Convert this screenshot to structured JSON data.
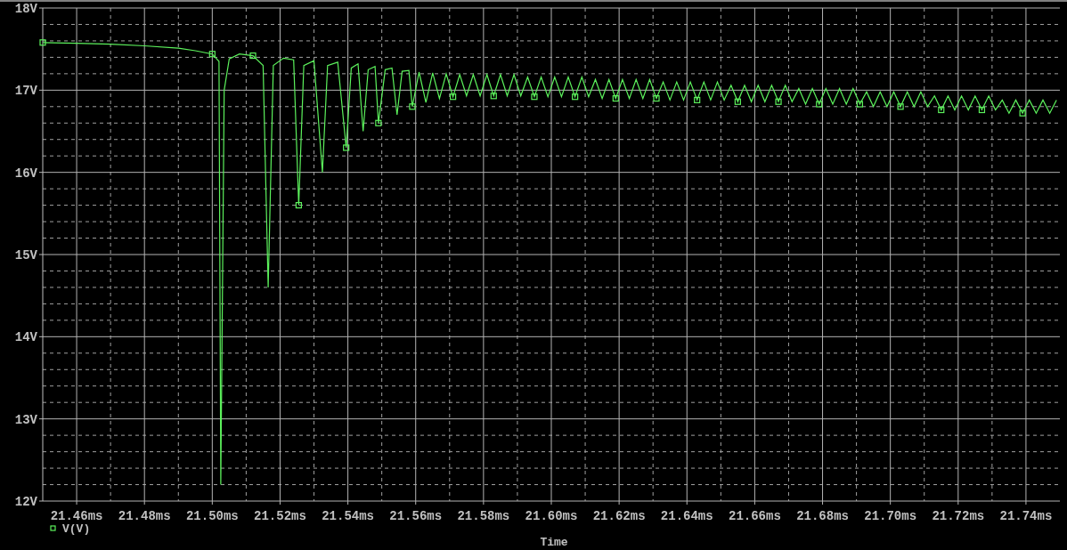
{
  "plot": {
    "chart_data": {
      "type": "line",
      "grid": true,
      "xlabel": "Time",
      "xlim": [
        21.45,
        21.75
      ],
      "ylim": [
        12,
        18
      ],
      "xticks": [
        {
          "value": 21.46,
          "label": "21.46ms"
        },
        {
          "value": 21.48,
          "label": "21.48ms"
        },
        {
          "value": 21.5,
          "label": "21.50ms"
        },
        {
          "value": 21.52,
          "label": "21.52ms"
        },
        {
          "value": 21.54,
          "label": "21.54ms"
        },
        {
          "value": 21.56,
          "label": "21.56ms"
        },
        {
          "value": 21.58,
          "label": "21.58ms"
        },
        {
          "value": 21.6,
          "label": "21.60ms"
        },
        {
          "value": 21.62,
          "label": "21.62ms"
        },
        {
          "value": 21.64,
          "label": "21.64ms"
        },
        {
          "value": 21.66,
          "label": "21.66ms"
        },
        {
          "value": 21.68,
          "label": "21.68ms"
        },
        {
          "value": 21.7,
          "label": "21.70ms"
        },
        {
          "value": 21.72,
          "label": "21.72ms"
        },
        {
          "value": 21.74,
          "label": "21.74ms"
        }
      ],
      "yticks": [
        {
          "value": 12,
          "label": "12V"
        },
        {
          "value": 13,
          "label": "13V"
        },
        {
          "value": 14,
          "label": "14V"
        },
        {
          "value": 15,
          "label": "15V"
        },
        {
          "value": 16,
          "label": "16V"
        },
        {
          "value": 17,
          "label": "17V"
        },
        {
          "value": 18,
          "label": "18V"
        }
      ],
      "x": [
        21.45,
        21.46,
        21.47,
        21.48,
        21.49,
        21.495,
        21.5,
        21.502,
        21.5025,
        21.5035,
        21.505,
        21.508,
        21.512,
        21.515,
        21.5165,
        21.518,
        21.521,
        21.524,
        21.5255,
        21.527,
        21.53,
        21.5325,
        21.534,
        21.537,
        21.5395,
        21.541,
        21.543,
        21.5445,
        21.546,
        21.548,
        21.549,
        21.551,
        21.553,
        21.5545,
        21.556,
        21.558,
        21.559,
        21.561,
        21.563,
        21.565,
        21.567,
        21.569,
        21.571,
        21.573,
        21.575,
        21.577,
        21.579,
        21.581,
        21.583,
        21.585,
        21.587,
        21.589,
        21.591,
        21.593,
        21.595,
        21.597,
        21.599,
        21.601,
        21.603,
        21.605,
        21.607,
        21.609,
        21.611,
        21.613,
        21.615,
        21.617,
        21.619,
        21.621,
        21.623,
        21.625,
        21.627,
        21.629,
        21.631,
        21.633,
        21.635,
        21.637,
        21.639,
        21.641,
        21.643,
        21.645,
        21.647,
        21.649,
        21.651,
        21.653,
        21.655,
        21.657,
        21.659,
        21.661,
        21.663,
        21.665,
        21.667,
        21.669,
        21.671,
        21.673,
        21.675,
        21.677,
        21.679,
        21.681,
        21.683,
        21.685,
        21.687,
        21.689,
        21.691,
        21.693,
        21.695,
        21.697,
        21.699,
        21.701,
        21.703,
        21.705,
        21.707,
        21.709,
        21.711,
        21.713,
        21.715,
        21.717,
        21.719,
        21.721,
        21.723,
        21.725,
        21.727,
        21.729,
        21.731,
        21.733,
        21.735,
        21.737,
        21.739,
        21.741,
        21.743,
        21.745,
        21.747,
        21.749
      ],
      "series": [
        {
          "name": "V(V)",
          "color": "#5cf25c",
          "values": [
            17.58,
            17.57,
            17.56,
            17.54,
            17.51,
            17.48,
            17.44,
            17.35,
            12.2,
            17.0,
            17.38,
            17.44,
            17.42,
            17.3,
            14.6,
            17.3,
            17.39,
            17.37,
            15.6,
            17.3,
            17.36,
            16.0,
            17.3,
            17.34,
            16.3,
            17.27,
            17.32,
            16.5,
            17.25,
            17.29,
            16.6,
            17.25,
            17.27,
            16.7,
            17.23,
            17.24,
            16.8,
            17.22,
            16.85,
            17.21,
            16.9,
            17.2,
            16.92,
            17.19,
            16.93,
            17.19,
            16.93,
            17.19,
            16.93,
            17.19,
            16.93,
            17.19,
            16.93,
            17.16,
            16.92,
            17.16,
            16.92,
            17.16,
            16.92,
            17.16,
            16.92,
            17.16,
            16.92,
            17.13,
            16.9,
            17.13,
            16.9,
            17.13,
            16.9,
            17.13,
            16.9,
            17.13,
            16.9,
            17.1,
            16.88,
            17.1,
            16.88,
            17.1,
            16.88,
            17.1,
            16.88,
            17.1,
            16.88,
            17.06,
            16.86,
            17.06,
            16.86,
            17.06,
            16.86,
            17.06,
            16.86,
            17.06,
            16.86,
            17.02,
            16.83,
            17.02,
            16.83,
            17.02,
            16.83,
            17.02,
            16.83,
            17.02,
            16.83,
            16.98,
            16.8,
            16.98,
            16.8,
            16.98,
            16.8,
            16.98,
            16.8,
            16.98,
            16.8,
            16.93,
            16.76,
            16.93,
            16.76,
            16.93,
            16.76,
            16.93,
            16.76,
            16.93,
            16.76,
            16.88,
            16.72,
            16.88,
            16.72,
            16.88,
            16.72,
            16.88,
            16.72,
            16.88
          ]
        }
      ]
    }
  }
}
